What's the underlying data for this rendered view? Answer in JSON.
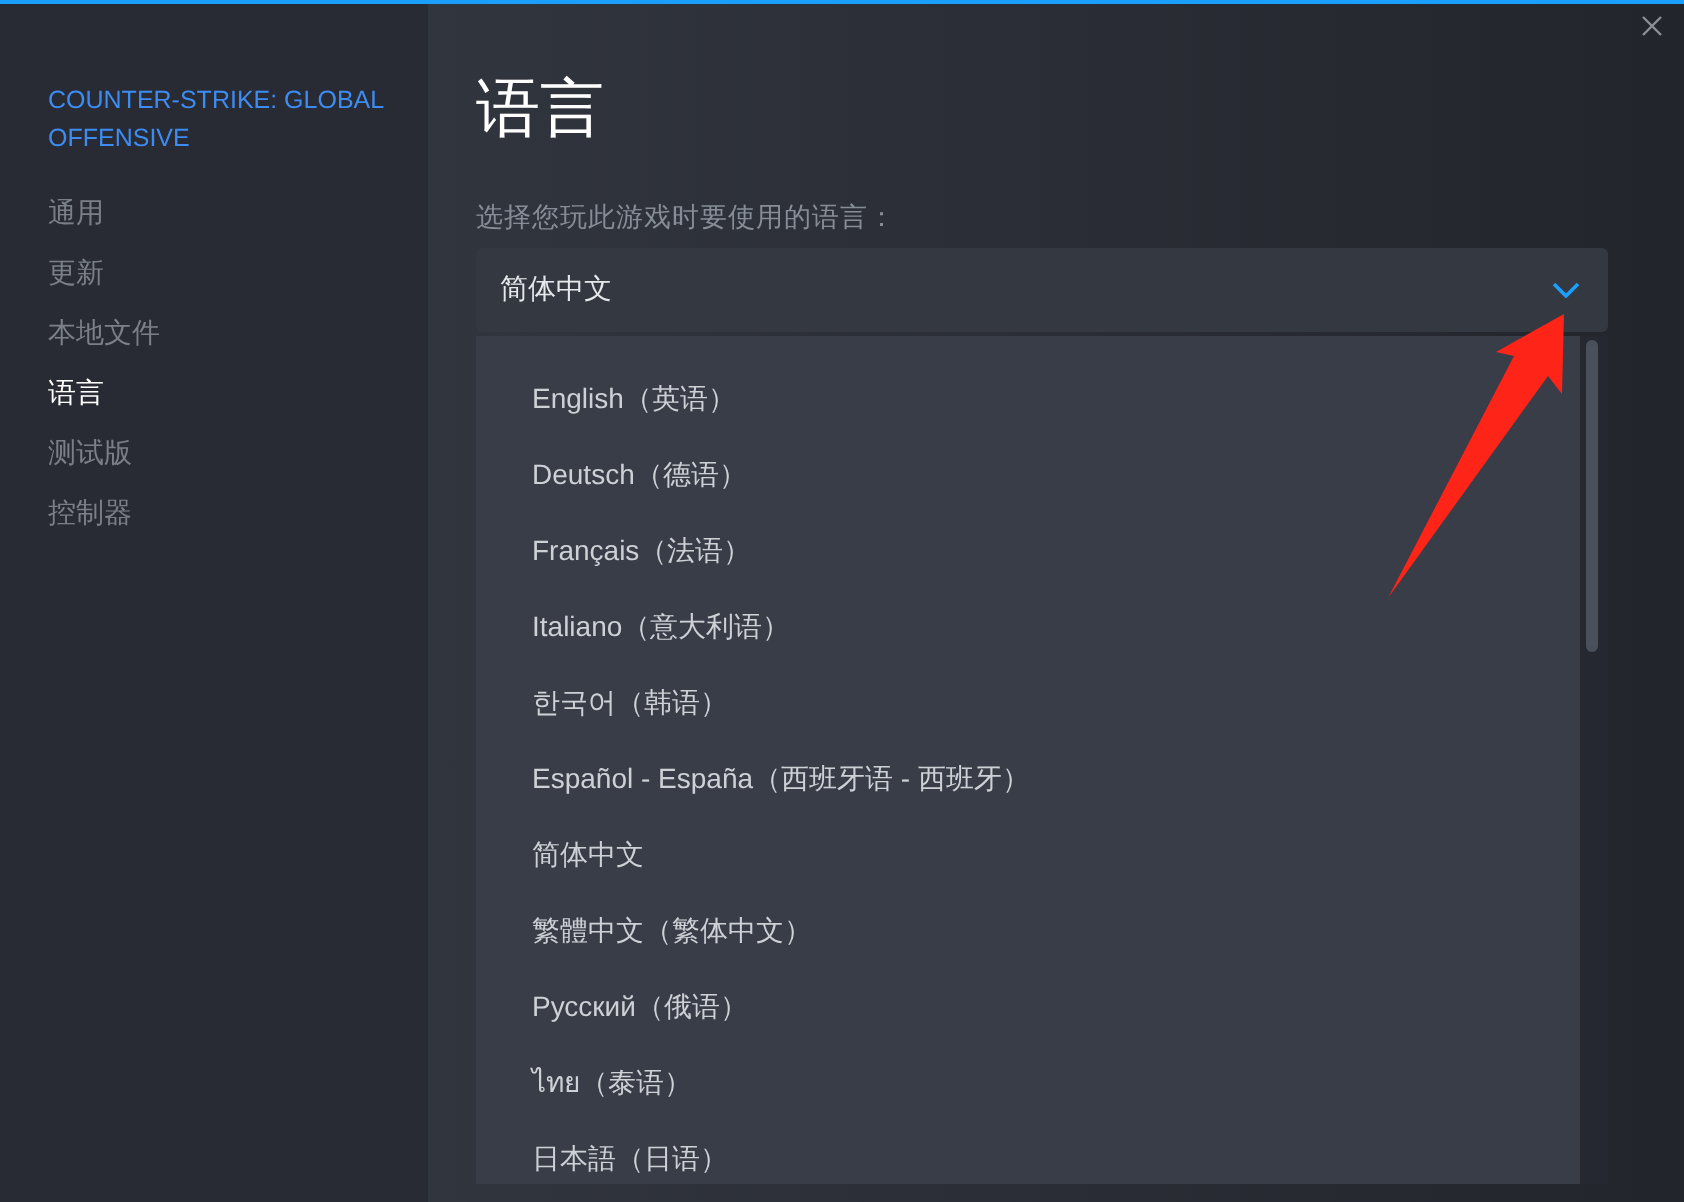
{
  "sidebar": {
    "game_title": "COUNTER-STRIKE: GLOBAL OFFENSIVE",
    "items": [
      {
        "label": "通用",
        "selected": false
      },
      {
        "label": "更新",
        "selected": false
      },
      {
        "label": "本地文件",
        "selected": false
      },
      {
        "label": "语言",
        "selected": true
      },
      {
        "label": "测试版",
        "selected": false
      },
      {
        "label": "控制器",
        "selected": false
      }
    ]
  },
  "page": {
    "title": "语言",
    "prompt": "选择您玩此游戏时要使用的语言：",
    "dropdown": {
      "value": "简体中文",
      "expanded": true,
      "options": [
        "English（英语）",
        "Deutsch（德语）",
        "Français（法语）",
        "Italiano（意大利语）",
        "한국어（韩语）",
        "Español - España（西班牙语 - 西班牙）",
        "简体中文",
        "繁體中文（繁体中文）",
        "Русский（俄语）",
        "ไทย（泰语）",
        "日本語（日语）"
      ]
    }
  }
}
